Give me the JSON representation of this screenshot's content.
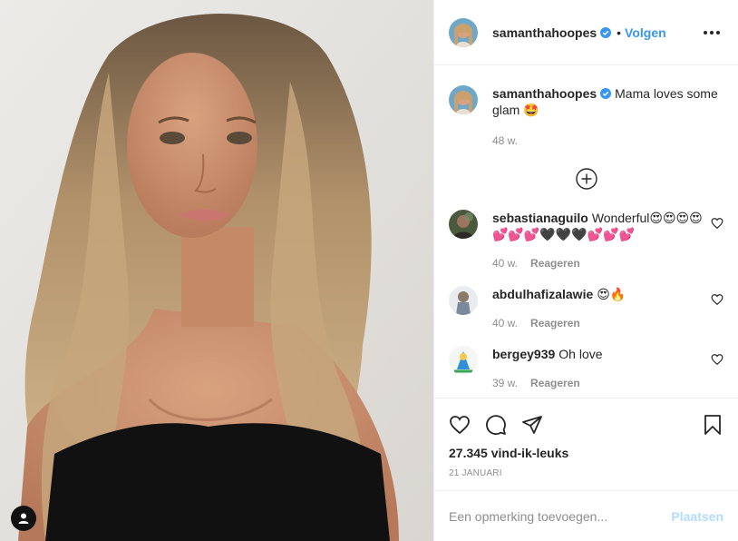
{
  "post": {
    "username": "samanthahoopes",
    "follow_label": "Volgen",
    "dot": "•",
    "verified": true
  },
  "caption": {
    "username": "samanthahoopes",
    "text": "Mama loves some glam 🤩",
    "time": "48 w."
  },
  "comments": [
    {
      "username": "sebastianaguilo",
      "text": "Wonderful😍😍😍😍💕💕💕🖤🖤🖤💕💕💕",
      "time": "40 w.",
      "reply_label": "Reageren",
      "avatar": "avatar-sebastianaguilo"
    },
    {
      "username": "abdulhafizalawie",
      "text": "😍🔥",
      "time": "40 w.",
      "reply_label": "Reageren",
      "avatar": "avatar-abdulhafizalawie"
    },
    {
      "username": "bergey939",
      "text": "Oh love",
      "time": "39 w.",
      "reply_label": "Reageren",
      "avatar": "avatar-bergey939"
    }
  ],
  "actions": {
    "icons": [
      "heart-icon",
      "comment-icon",
      "share-icon",
      "bookmark-icon"
    ]
  },
  "likes_text": "27.345 vind-ik-leuks",
  "date_text": "21 JANUARI",
  "add_comment": {
    "placeholder": "Een opmerking toevoegen...",
    "post_label": "Plaatsen"
  },
  "colors": {
    "link_blue": "#3897f0",
    "post_disabled": "#b3dbff",
    "muted": "#8e8e8e",
    "border": "#efefef"
  }
}
